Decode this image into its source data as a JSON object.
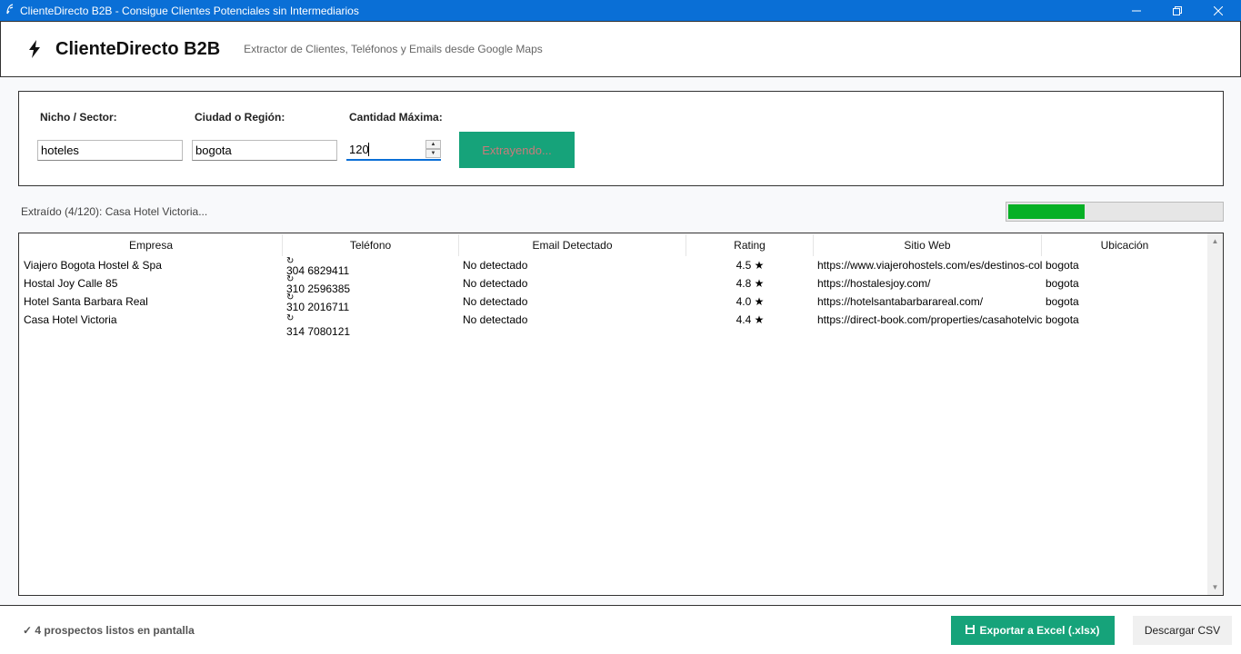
{
  "window": {
    "title": "ClienteDirecto B2B - Consigue Clientes Potenciales sin Intermediarios"
  },
  "header": {
    "app_name": "ClienteDirecto B2B",
    "subtitle": "Extractor de Clientes, Teléfonos y Emails desde Google Maps"
  },
  "form": {
    "niche_label": "Nicho / Sector:",
    "niche_value": "hoteles",
    "city_label": "Ciudad o Región:",
    "city_value": "bogota",
    "max_label": "Cantidad Máxima:",
    "max_value": "120",
    "extract_label": "Extrayendo..."
  },
  "status": {
    "text": "Extraído (4/120): Casa Hotel Victoria...",
    "progress_percent": 36
  },
  "table": {
    "columns": [
      "Empresa",
      "Teléfono",
      "Email Detectado",
      "Rating",
      "Sitio Web",
      "Ubicación"
    ],
    "rows": [
      {
        "empresa": "Viajero Bogota Hostel & Spa",
        "telefono": "304 6829411",
        "email": "No detectado",
        "rating": "4.5 ★",
        "web": "https://www.viajerohostels.com/es/destinos-colombia/bogota",
        "ubicacion": "bogota"
      },
      {
        "empresa": "Hostal Joy Calle 85",
        "telefono": "310 2596385",
        "email": "No detectado",
        "rating": "4.8 ★",
        "web": "https://hostalesjoy.com/",
        "ubicacion": "bogota"
      },
      {
        "empresa": "Hotel Santa Barbara Real",
        "telefono": "310 2016711",
        "email": "No detectado",
        "rating": "4.0 ★",
        "web": "https://hotelsantabarbarareal.com/",
        "ubicacion": "bogota"
      },
      {
        "empresa": "Casa Hotel Victoria",
        "telefono": "314 7080121",
        "email": "No detectado",
        "rating": "4.4 ★",
        "web": "https://direct-book.com/properties/casahotelvictoria",
        "ubicacion": "bogota"
      }
    ]
  },
  "footer": {
    "message": "4 prospectos listos en pantalla",
    "excel_label": "Exportar a Excel (.xlsx)",
    "csv_label": "Descargar CSV"
  },
  "colors": {
    "titlebar": "#0a6fd6",
    "accent_green": "#16a37a",
    "progress_green": "#06b025"
  },
  "icons": {
    "app": "feather-icon",
    "header": "bolt-icon",
    "phone": "phone-refresh-icon",
    "footer_check": "check-icon",
    "excel": "save-icon"
  }
}
